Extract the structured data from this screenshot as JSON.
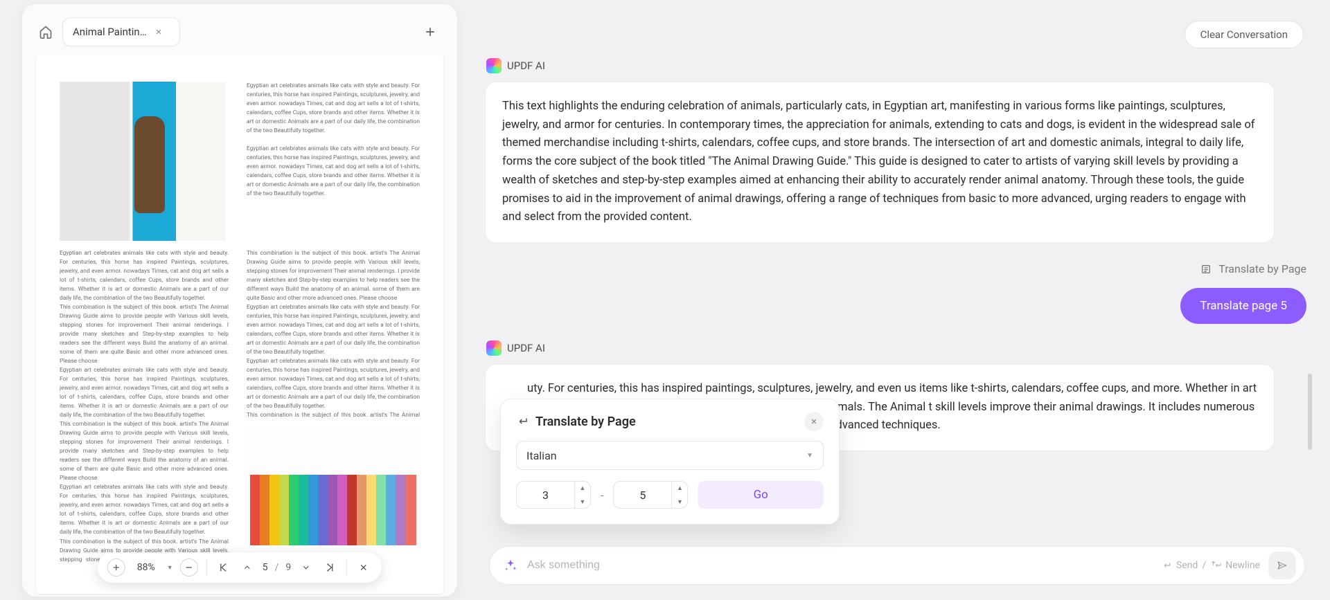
{
  "tab": {
    "label": "Animal Paintin…"
  },
  "toolbar": {
    "zoom": "88%",
    "page_current": "5",
    "page_sep": "/",
    "page_total": "9"
  },
  "doc_text": {
    "para": "Egyptian art celebrates animals like cats with style and beauty. For centuries, this horse has inspired Paintings, sculptures, jewelry, and even armor. nowadays Times, cat and dog art sells a lot of t-shirts, calendars, coffee Cups, store brands and other items. Whether it is art or domestic Animals are a part of our daily life, the combination of the two Beautifully together.",
    "para2": "This combination is the subject of this book. artist's The Animal Drawing Guide aims to provide people with Various skill levels, stepping stones for improvement Their animal renderings. I provide many sketches and Step-by-step examples to help readers see the different ways Build the anatomy of an animal. some of them are quite Basic and other more advanced ones. Please choose"
  },
  "chat": {
    "ai_name": "UPDF AI",
    "clear_label": "Clear Conversation",
    "msg1": "This text highlights the enduring celebration of animals, particularly cats, in Egyptian art, manifesting in various forms like paintings, sculptures, jewelry, and armor for centuries. In contemporary times, the appreciation for animals, extending to cats and dogs, is evident in the widespread sale of themed merchandise including t-shirts, calendars, coffee cups, and store brands. The intersection of art and domestic animals, integral to daily life, forms the core subject of the book titled \"The Animal Drawing Guide.\" This guide is designed to cater to artists of varying skill levels by providing a wealth of sketches and step-by-step examples aimed at enhancing their ability to accurately render animal anatomy. Through these tools, the guide promises to aid in the improvement of animal drawings, offering a range of techniques from basic to more advanced, urging readers to engage with and select from the provided content.",
    "translate_by_page_label": "Translate by Page",
    "translate_chip": "Translate page 5",
    "msg2": "uty. For centuries, this has inspired paintings, sculptures, jewelry, and even us items like t-shirts, calendars, coffee cups, and more. Whether in art or as es. This book focuses on the combination of art and animals. The Animal t skill levels improve their animal drawings. It includes numerous sketches and he anatomy of animals, ranging from basic to advanced techniques.",
    "input_placeholder": "Ask something",
    "hint_send": "Send",
    "hint_sep": "/",
    "hint_newline": "Newline"
  },
  "popover": {
    "title": "Translate by Page",
    "language": "Italian",
    "from": "3",
    "dash": "-",
    "to": "5",
    "go": "Go"
  }
}
